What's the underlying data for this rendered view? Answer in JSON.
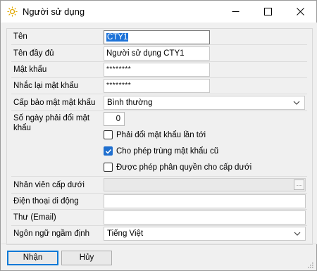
{
  "window": {
    "title": "Người sử dụng",
    "icon": "sun-icon",
    "controls": [
      "minimize-icon",
      "maximize-icon",
      "close-icon"
    ]
  },
  "form": {
    "username": {
      "label": "Tên",
      "value": "CTY1"
    },
    "fullname": {
      "label": "Tên đầy đủ",
      "value": "Người sử dụng CTY1"
    },
    "password": {
      "label": "Mật khẩu",
      "value": "********"
    },
    "password_confirm": {
      "label": "Nhắc lại mật khẩu",
      "value": "********"
    },
    "security_level": {
      "label": "Cấp bảo mật mật khẩu",
      "value": "Bình thường"
    },
    "days_to_change": {
      "label": "Số ngày phải đổi mật khẩu",
      "value": "0"
    },
    "must_change": {
      "label": "Phải đổi mật khẩu lần tới",
      "checked": false
    },
    "allow_duplicate": {
      "label": "Cho phép trùng mật khẩu cũ",
      "checked": true
    },
    "allow_delegate": {
      "label": "Được phép phân quyền cho cấp dưới",
      "checked": false
    },
    "subordinate": {
      "label": "Nhân viên cấp dưới",
      "value": "",
      "button": "..."
    },
    "mobile": {
      "label": "Điện thoại di động",
      "value": ""
    },
    "email": {
      "label": "Thư (Email)",
      "value": ""
    },
    "language": {
      "label": "Ngôn ngữ ngầm định",
      "value": "Tiếng Việt"
    }
  },
  "buttons": {
    "ok": "Nhận",
    "cancel": "Hủy"
  },
  "colors": {
    "accent": "#1f6fcf",
    "selection": "#1e73d8",
    "window_bg": "#f0f0f0"
  }
}
